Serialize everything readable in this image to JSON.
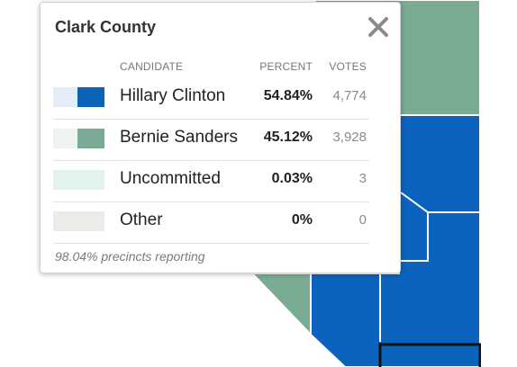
{
  "popup": {
    "title": "Clark County",
    "headers": {
      "candidate": "CANDIDATE",
      "percent": "PERCENT",
      "votes": "VOTES"
    },
    "rows": [
      {
        "name": "Hillary Clinton",
        "percent": "54.84%",
        "votes": "4,774",
        "swatch_light": "#e4edf8",
        "swatch_dark": "#0d63b8"
      },
      {
        "name": "Bernie Sanders",
        "percent": "45.12%",
        "votes": "3,928",
        "swatch_light": "#eef3f0",
        "swatch_dark": "#7aa994"
      },
      {
        "name": "Uncommitted",
        "percent": "0.03%",
        "votes": "3",
        "swatch": "#e1f3ed"
      },
      {
        "name": "Other",
        "percent": "0%",
        "votes": "0",
        "swatch": "#ebece7"
      }
    ],
    "footnote": "98.04% precincts reporting",
    "close_icon": "close-x-icon"
  },
  "map": {
    "colors": {
      "clinton": "#0b63be",
      "sanders": "#7aab93",
      "background": "#ffffff",
      "border": "#ffffff",
      "highlight_border": "#111111"
    }
  }
}
